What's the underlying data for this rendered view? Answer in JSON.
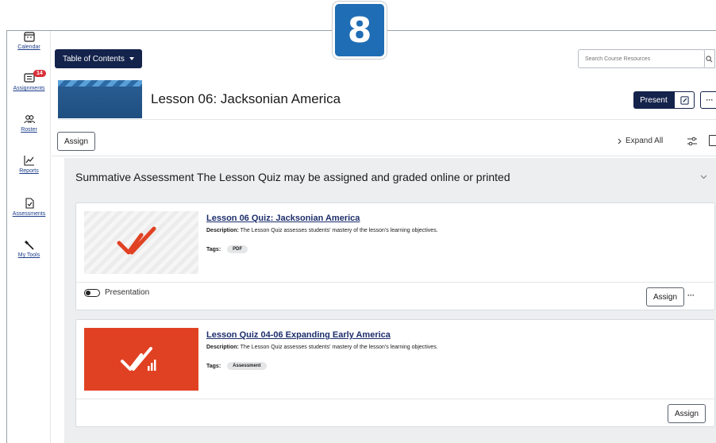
{
  "step_badge": "8",
  "sidebar": {
    "items": [
      {
        "label": "Calendar",
        "icon": "calendar-icon"
      },
      {
        "label": "Assignments",
        "icon": "assignments-icon",
        "badge": "14"
      },
      {
        "label": "Roster",
        "icon": "roster-icon"
      },
      {
        "label": "Reports",
        "icon": "reports-icon"
      },
      {
        "label": "Assessments",
        "icon": "assessments-icon"
      },
      {
        "label": "My Tools",
        "icon": "tools-icon"
      }
    ]
  },
  "header": {
    "toc_label": "Table of Contents",
    "search_placeholder": "Search Course Resources"
  },
  "lesson": {
    "title": "Lesson 06: Jacksonian America",
    "present_label": "Present",
    "more_label": "···"
  },
  "toolbar": {
    "assign_label": "Assign",
    "expand_all_label": "Expand All"
  },
  "section": {
    "title": "Summative Assessment The Lesson Quiz may be assigned and graded online or printed"
  },
  "cards": [
    {
      "title": "Lesson 06 Quiz: Jacksonian America",
      "desc_label": "Description:",
      "desc": "The Lesson Quiz assesses students' mastery of the lesson's learning objectives.",
      "tags_label": "Tags:",
      "tag": "PDF",
      "toggle_label": "Presentation",
      "assign_label": "Assign",
      "more_label": "···"
    },
    {
      "title": "Lesson Quiz 04-06 Expanding Early America",
      "desc_label": "Description:",
      "desc": "The Lesson Quiz assesses students' mastery of the lesson's learning objectives.",
      "tags_label": "Tags:",
      "tag": "Assessment",
      "assign_label": "Assign"
    }
  ],
  "colors": {
    "navy": "#14234b",
    "link_blue": "#1d2e6b",
    "badge_red": "#d8313a",
    "quiz_red": "#e14123",
    "step_blue": "#1f6db4"
  }
}
